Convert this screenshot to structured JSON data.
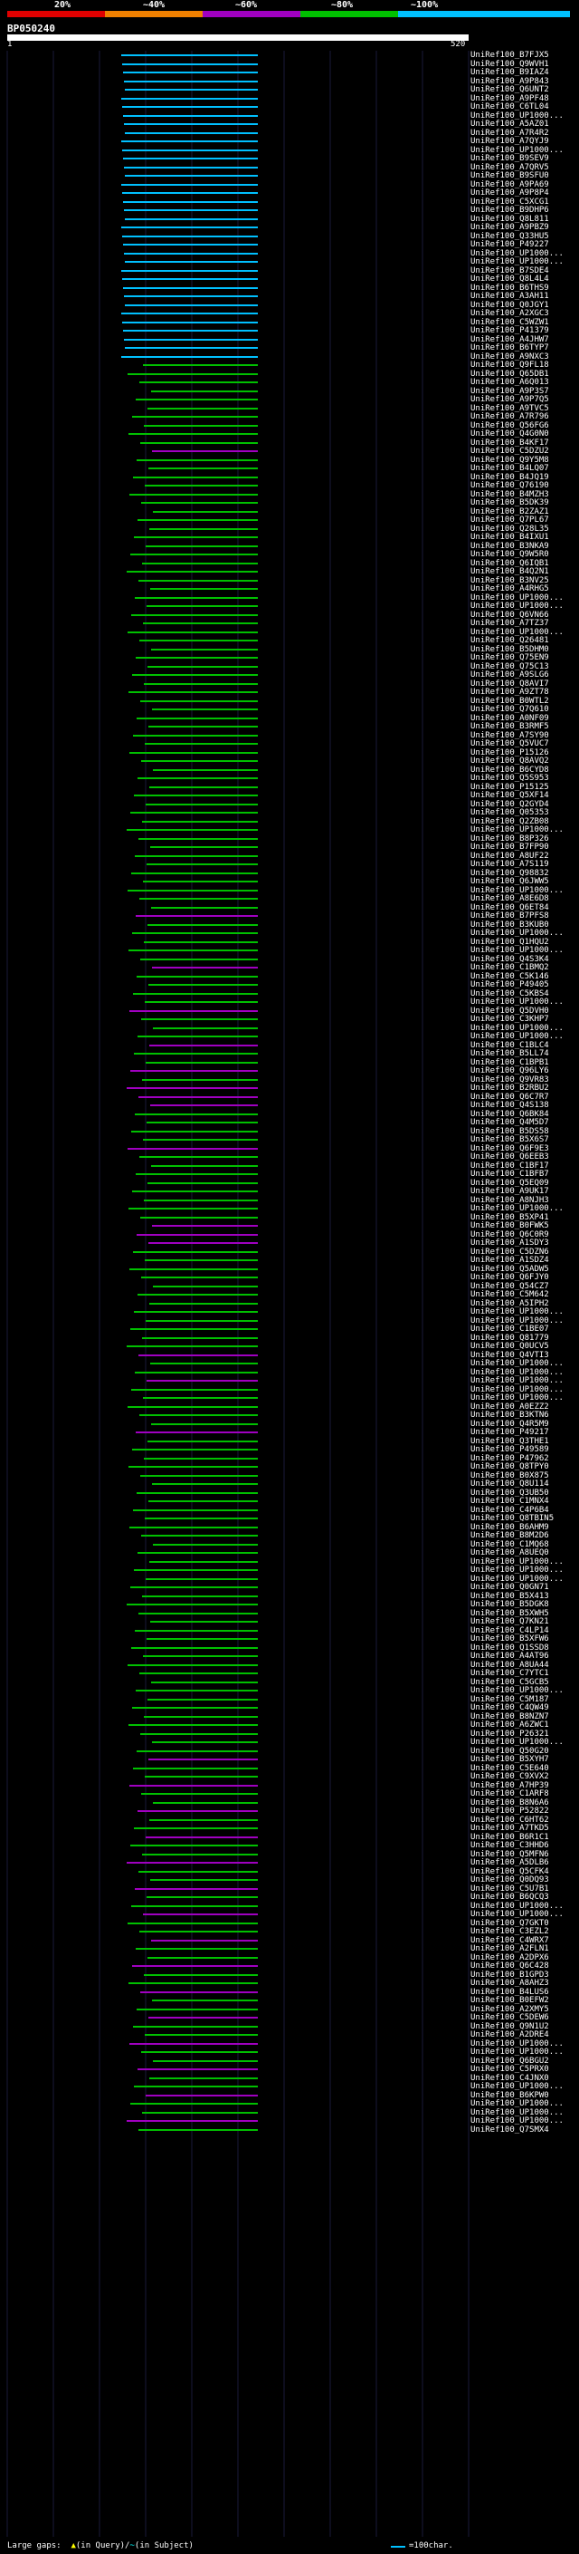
{
  "header": {
    "ticks": [
      "20%",
      "~40%",
      "~60%",
      "~80%",
      "~100%"
    ],
    "colors": [
      "#e00000",
      "#f08000",
      "#a000c0",
      "#00c000",
      "#00c0ff"
    ],
    "query_id": "BP050240",
    "ruler_start": "1",
    "ruler_end": "520"
  },
  "hits": {
    "prefix": "UniRef100_",
    "names": [
      "B7FJX5",
      "Q9WVH1",
      "B9IAZ4",
      "A9P843",
      "Q6UNT2",
      "A9PF48",
      "C6TL04",
      "UP1000...",
      "A5AZ01",
      "A7R4R2",
      "A7QYJ9",
      "UP1000...",
      "B9SEV9",
      "A7QRV5",
      "B9SFU0",
      "A9PA69",
      "A9P8P4",
      "C5XCG1",
      "B9DHP6",
      "Q8L811",
      "A9PBZ9",
      "Q33HU5",
      "P49227",
      "UP1000...",
      "UP1000...",
      "B7SDE4",
      "Q8L4L4",
      "B6THS9",
      "A3AH11",
      "Q0JGY1",
      "A2XGC3",
      "C5WZW1",
      "P41379",
      "A4JHW7",
      "B6TYP7",
      "A9NXC3",
      "Q9FL18",
      "Q65DB1",
      "A6Q013",
      "A9P3S7",
      "A9P7Q5",
      "A9TVC5",
      "A7R796",
      "Q56FG6",
      "Q4G0N0",
      "B4KF17",
      "C5DZU2",
      "Q9Y5M8",
      "B4LQ07",
      "B4JQ19",
      "Q76190",
      "B4MZH3",
      "B5DK39",
      "B2ZAZ1",
      "Q7PL67",
      "Q28L35",
      "B4IXU1",
      "B3NKA9",
      "Q9W5R0",
      "Q6IQB1",
      "B4Q2N1",
      "B3NV25",
      "A4RHG5",
      "UP1000...",
      "UP1000...",
      "Q6VN66",
      "A7TZ37",
      "UP1000...",
      "Q26481",
      "B5DHM0",
      "Q75EN9",
      "Q75C13",
      "A9SLG6",
      "Q8AVI7",
      "A9ZT78",
      "B0WTL2",
      "Q7Q610",
      "A0NF09",
      "B3RMF5",
      "A7SY90",
      "Q5VUC7",
      "P15126",
      "Q8AVQ2",
      "B6CYD8",
      "Q5S953",
      "P15125",
      "Q5XF14",
      "Q2GYD4",
      "Q05353",
      "Q2ZB08",
      "UP1000...",
      "B8P326",
      "B7FP90",
      "A8UF22",
      "A7S119",
      "Q98832",
      "Q6JWW5",
      "UP1000...",
      "A8E6D8",
      "Q6ET84",
      "B7PFS8",
      "B3KUB0",
      "UP1000...",
      "Q1HQU2",
      "UP1000...",
      "Q4S3K4",
      "C1BMQ2",
      "C5K146",
      "P49405",
      "C5KBS4",
      "UP1000...",
      "Q5DVH0",
      "C3KHP7",
      "UP1000...",
      "UP1000...",
      "C1BLC4",
      "B5LL74",
      "C1BPB1",
      "Q96LY6",
      "Q9VR83",
      "B2RBU2",
      "Q6C7R7",
      "Q4S138",
      "Q6BK84",
      "Q4M5D7",
      "B5DS58",
      "B5X6S7",
      "Q6F9E3",
      "Q6EEB3",
      "C1BF17",
      "C1BFB7",
      "Q5EQ09",
      "A9UK17",
      "A8NJH3",
      "UP1000...",
      "B5XP41",
      "B0FWK5",
      "Q6C0R9",
      "A1SDY3",
      "C5DZN6",
      "A1SDZ4",
      "Q5ADW5",
      "Q6FJY0",
      "Q54CZ7",
      "C5M642",
      "A5IPH2",
      "UP1000...",
      "UP1000...",
      "C1BE07",
      "Q81779",
      "Q0UCV5",
      "Q4VTI3",
      "UP1000...",
      "UP1000...",
      "UP1000...",
      "UP1000...",
      "UP1000...",
      "A0EZZ2",
      "B3KTN6",
      "Q4R5M9",
      "P49217",
      "Q3THE1",
      "P49589",
      "P47962",
      "Q8TPY0",
      "B0X875",
      "Q8U114",
      "Q3UB50",
      "C1MNX4",
      "C4P6B4",
      "Q8TBIN5",
      "B6AHM9",
      "B8M2D6",
      "C1MQ68",
      "A8UEQ0",
      "UP1000...",
      "UP1000...",
      "UP1000...",
      "Q0GN71",
      "B5X413",
      "B5DGK8",
      "B5XWH5",
      "Q7KN21",
      "C4LP14",
      "B5XFW6",
      "Q1SSD8",
      "A4AT96",
      "A8UA44",
      "C7YTC1",
      "C5GCB5",
      "UP1000...",
      "C5M187",
      "C4QW49",
      "B8NZN7",
      "A6ZWC1",
      "P26321",
      "UP1000...",
      "Q50G20",
      "B5XYH7",
      "C5E640",
      "C9XVX2",
      "A7HP39",
      "C1ARF8",
      "B8N6A6",
      "P52822",
      "C6HT62",
      "A7TKD5",
      "B6R1C1",
      "C3HHD6",
      "Q5MFN6",
      "A5DLB6",
      "Q5CFK4",
      "Q0DQ93",
      "C5U7B1",
      "B6QCQ3",
      "UP1000...",
      "UP1000...",
      "Q7GKT0",
      "C3EZL2",
      "C4WRX7",
      "A2FLN1",
      "A2DPX6",
      "Q6C428",
      "B1GPD3",
      "A8AHZ3",
      "B4LUS6",
      "B0EFW2",
      "A2XMY5",
      "C5DEW6",
      "Q9N1U2",
      "A2DRE4",
      "UP1000...",
      "UP1000...",
      "Q6BGU2",
      "C5PRX0",
      "C4JNX0",
      "UP1000...",
      "B6KPW0",
      "UP1000...",
      "UP1000...",
      "UP1000...",
      "Q7SMX4"
    ],
    "identity_colors": {
      "very_high": "#00c0ff",
      "high": "#00c000",
      "medium": "#a000c0"
    }
  },
  "footer": {
    "gaps_label": "Large gaps:",
    "in_query": "(in Query)/",
    "in_subject": "(in Subject)",
    "scale_label": "=100char."
  }
}
